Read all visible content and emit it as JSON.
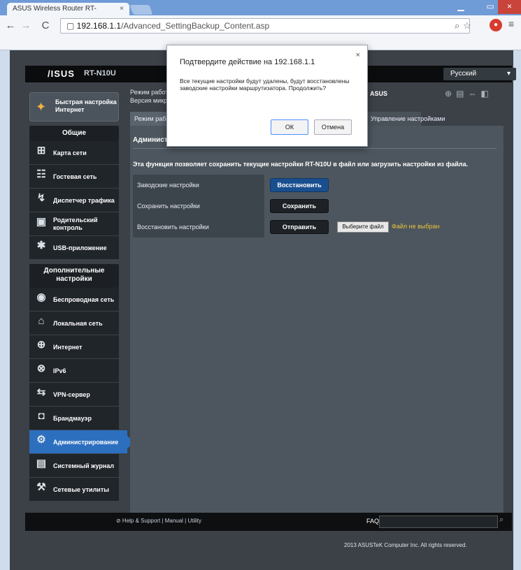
{
  "browser": {
    "tab_title": "ASUS Wireless Router RT-",
    "tab_close": "×",
    "url_host": "192.168.1.1",
    "url_path": "/Advanced_SettingBackup_Content.asp",
    "win_min": "▁",
    "win_max": "▭",
    "win_close": "×"
  },
  "router": {
    "logo": "/ISUS",
    "model": "RT-N10U",
    "language": "Русский",
    "quick_setup": "Быстрая настройка Интернет",
    "info_line1": "Режим работы:",
    "info_line2": "Версия микропрограммы:",
    "ssid": "ASUS",
    "tab_first": "Режим работы",
    "tab_active": "Управление настройками",
    "sections": {
      "general": "Общие",
      "advanced": "Дополнительные настройки"
    },
    "menu_general": [
      {
        "icon": "network-map-icon",
        "glyph": "⊞",
        "label": "Карта сети"
      },
      {
        "icon": "guest-network-icon",
        "glyph": "☷",
        "label": "Гостевая сеть"
      },
      {
        "icon": "traffic-manager-icon",
        "glyph": "↯",
        "label": "Диспетчер трафика"
      },
      {
        "icon": "parental-control-icon",
        "glyph": "▣",
        "label": "Родительский контроль"
      },
      {
        "icon": "usb-app-icon",
        "glyph": "✱",
        "label": "USB-приложение"
      }
    ],
    "menu_advanced": [
      {
        "icon": "wireless-icon",
        "glyph": "◉",
        "label": "Беспроводная сеть",
        "active": false
      },
      {
        "icon": "lan-icon",
        "glyph": "⌂",
        "label": "Локальная сеть",
        "active": false
      },
      {
        "icon": "wan-icon",
        "glyph": "⊕",
        "label": "Интернет",
        "active": false
      },
      {
        "icon": "ipv6-icon",
        "glyph": "⊗",
        "label": "IPv6",
        "active": false
      },
      {
        "icon": "vpn-icon",
        "glyph": "⇆",
        "label": "VPN-сервер",
        "active": false
      },
      {
        "icon": "firewall-icon",
        "glyph": "◘",
        "label": "Брандмауэр",
        "active": false
      },
      {
        "icon": "administration-icon",
        "glyph": "⚙",
        "label": "Администрирование",
        "active": true
      },
      {
        "icon": "system-log-icon",
        "glyph": "▤",
        "label": "Системный журнал",
        "active": false
      },
      {
        "icon": "network-tools-icon",
        "glyph": "⚒",
        "label": "Сетевые утилиты",
        "active": false
      }
    ],
    "panel_title": "Администрирование - Управление настройками",
    "panel_desc": "Эта функция позволяет сохранить текущие настройки RT-N10U в файл или загрузить настройки из файла.",
    "rows": {
      "factory_label": "Заводские настройки",
      "factory_button": "Восстановить",
      "save_label": "Сохранить настройки",
      "save_button": "Сохранить",
      "restore_label": "Восстановить настройки",
      "restore_button": "Отправить",
      "file_button": "Выберите файл",
      "file_status": "Файл не выбран"
    },
    "footer": {
      "links": "⊘ Help & Support | Manual | Utility",
      "faq": "FAQ",
      "copyright": "2013 ASUSTeK Computer Inc. All rights reserved."
    }
  },
  "dialog": {
    "title": "Подтвердите действие на 192.168.1.1",
    "message": "Все текущие настройки будут удалены, будут восстановлены заводские настройки маршрутизатора. Продолжить?",
    "ok": "ОК",
    "cancel": "Отмена",
    "close": "×"
  }
}
